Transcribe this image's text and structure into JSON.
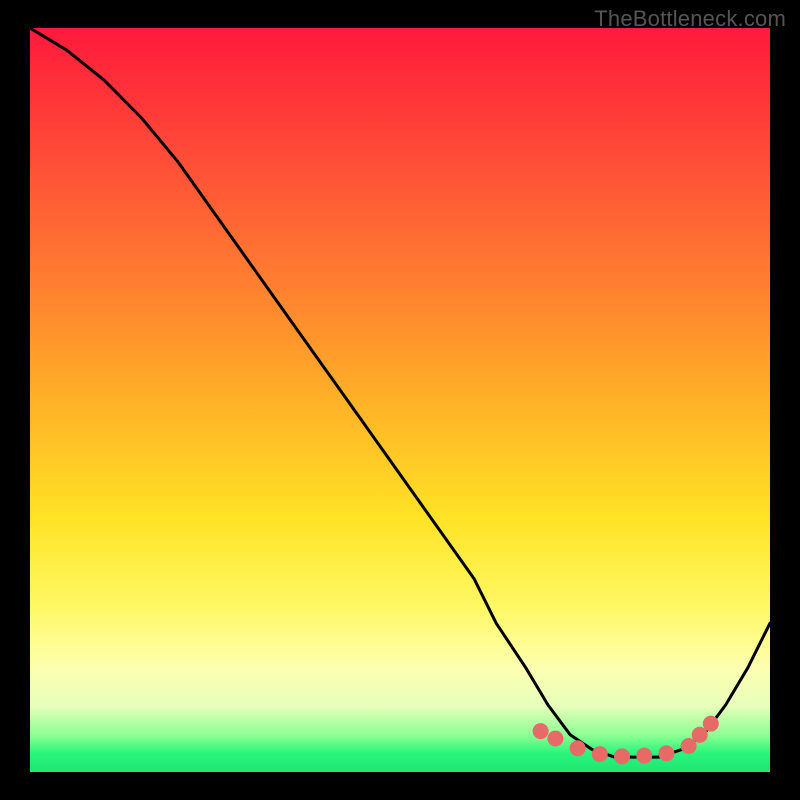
{
  "watermark": "TheBottleneck.com",
  "chart_data": {
    "type": "line",
    "title": "",
    "xlabel": "",
    "ylabel": "",
    "xlim": [
      0,
      100
    ],
    "ylim": [
      0,
      100
    ],
    "series": [
      {
        "name": "curve",
        "x": [
          0,
          5,
          10,
          15,
          20,
          25,
          30,
          35,
          40,
          45,
          50,
          55,
          60,
          63,
          67,
          70,
          73,
          76,
          79,
          82,
          85,
          88,
          91,
          94,
          97,
          100
        ],
        "y": [
          100,
          97,
          93,
          88,
          82,
          75,
          68,
          61,
          54,
          47,
          40,
          33,
          26,
          20,
          14,
          9,
          5,
          3,
          2,
          2,
          2,
          3,
          5,
          9,
          14,
          20
        ]
      }
    ],
    "markers": {
      "name": "highlight-points",
      "color": "#e86a66",
      "x": [
        69,
        71,
        74,
        77,
        80,
        83,
        86,
        89,
        90.5,
        92
      ],
      "y": [
        5.5,
        4.5,
        3.2,
        2.4,
        2.1,
        2.2,
        2.5,
        3.5,
        5.0,
        6.5
      ]
    }
  }
}
